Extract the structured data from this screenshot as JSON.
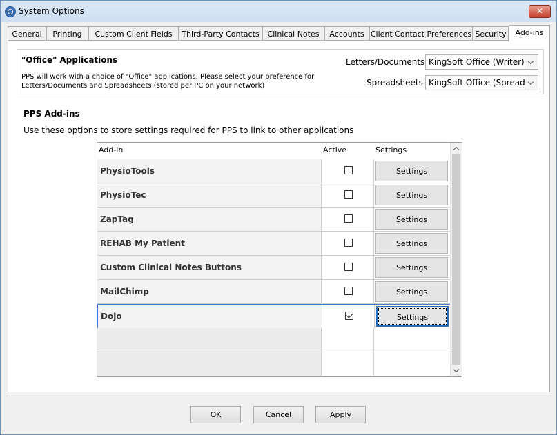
{
  "window": {
    "title": "System Options",
    "close_symbol": "✕"
  },
  "tabs": [
    {
      "label": "General"
    },
    {
      "label": "Printing"
    },
    {
      "label": "Custom Client Fields"
    },
    {
      "label": "Third-Party Contacts"
    },
    {
      "label": "Clinical Notes"
    },
    {
      "label": "Accounts"
    },
    {
      "label": "Client Contact Preferences"
    },
    {
      "label": "Security"
    },
    {
      "label": "Add-ins",
      "active": true
    }
  ],
  "office": {
    "title": "\"Office\" Applications",
    "description": "PPS will work with a choice of \"Office\" applications. Please select your preference for Letters/Documents and Spreadsheets (stored per PC on your network)",
    "letters_label": "Letters/Documents",
    "letters_value": "KingSoft Office (Writer)",
    "spreadsheets_label": "Spreadsheets",
    "spreadsheets_value": "KingSoft Office (Spreadsheets)"
  },
  "addins": {
    "title": "PPS Add-ins",
    "description": "Use these options to store settings required for PPS to link to other applications",
    "columns": {
      "name": "Add-in",
      "active": "Active",
      "settings": "Settings"
    },
    "button_label": "Settings",
    "rows": [
      {
        "name": "PhysioTools",
        "active": false
      },
      {
        "name": "PhysioTec",
        "active": false
      },
      {
        "name": "ZapTag",
        "active": false
      },
      {
        "name": "REHAB My Patient",
        "active": false
      },
      {
        "name": "Custom Clinical Notes Buttons",
        "active": false
      },
      {
        "name": "MailChimp",
        "active": false
      },
      {
        "name": "Dojo",
        "active": true,
        "selected": true
      }
    ]
  },
  "footer": {
    "ok": "OK",
    "cancel": "Cancel",
    "apply": "Apply"
  }
}
